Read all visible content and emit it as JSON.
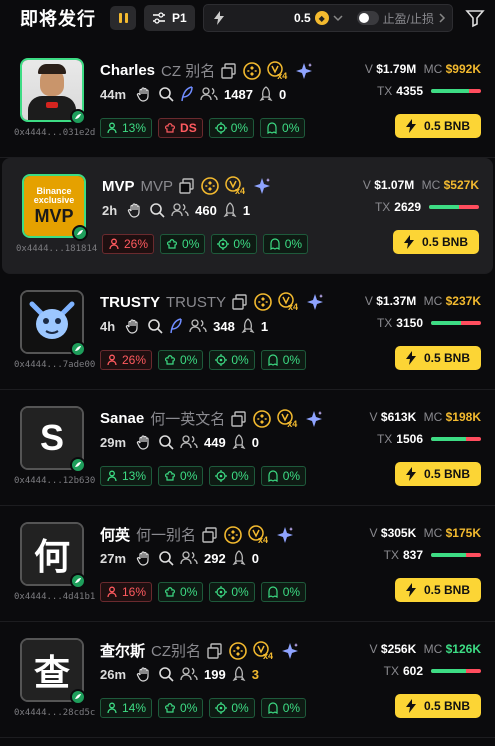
{
  "header": {
    "title": "即将发行",
    "preset_label": "P1",
    "quick_amount": "0.5",
    "tpsl_label": "止盈/止损"
  },
  "cards": [
    {
      "name": "Charles",
      "alias": "CZ 别名",
      "age": "44m",
      "holders": "1487",
      "snipers": "0",
      "address": "0x4444...031e2d",
      "volume": "$1.79M",
      "mcap": "$992K",
      "tx": "4355",
      "buy_ratio": 0.75,
      "stats": [
        "13%",
        "DS",
        "0%",
        "0%"
      ],
      "stat_colors": [
        "green",
        "red",
        "green",
        "green"
      ],
      "avatar": "photo",
      "highlight": false,
      "mc_color": "#f3ba2f"
    },
    {
      "name": "MVP",
      "alias": "MVP",
      "age": "2h",
      "holders": "460",
      "snipers": "1",
      "address": "0x4444...181814",
      "volume": "$1.07M",
      "mcap": "$527K",
      "tx": "2629",
      "buy_ratio": 0.6,
      "stats": [
        "26%",
        "0%",
        "0%",
        "0%"
      ],
      "stat_colors": [
        "red",
        "green",
        "green",
        "green"
      ],
      "avatar": "mvp",
      "highlight": true,
      "mc_color": "#f3ba2f"
    },
    {
      "name": "TRUSTY",
      "alias": "TRUSTY",
      "age": "4h",
      "holders": "348",
      "snipers": "1",
      "address": "0x4444...7ade00",
      "volume": "$1.37M",
      "mcap": "$237K",
      "tx": "3150",
      "buy_ratio": 0.6,
      "stats": [
        "26%",
        "0%",
        "0%",
        "0%"
      ],
      "stat_colors": [
        "red",
        "green",
        "green",
        "green"
      ],
      "avatar": "trusty",
      "highlight": false,
      "mc_color": "#f3ba2f"
    },
    {
      "name": "Sanae",
      "alias": "何一英文名",
      "age": "29m",
      "holders": "449",
      "snipers": "0",
      "address": "0x4444...12b630",
      "volume": "$613K",
      "mcap": "$198K",
      "tx": "1506",
      "buy_ratio": 0.7,
      "stats": [
        "13%",
        "0%",
        "0%",
        "0%"
      ],
      "stat_colors": [
        "green",
        "green",
        "green",
        "green"
      ],
      "avatar": "S",
      "highlight": false,
      "mc_color": "#f3ba2f"
    },
    {
      "name": "何英",
      "alias": "何一别名",
      "age": "27m",
      "holders": "292",
      "snipers": "0",
      "address": "0x4444...4d41b1",
      "volume": "$305K",
      "mcap": "$175K",
      "tx": "837",
      "buy_ratio": 0.7,
      "stats": [
        "16%",
        "0%",
        "0%",
        "0%"
      ],
      "stat_colors": [
        "red",
        "green",
        "green",
        "green"
      ],
      "avatar": "何",
      "highlight": false,
      "mc_color": "#f3ba2f"
    },
    {
      "name": "查尔斯",
      "alias": "CZ别名",
      "age": "26m",
      "holders": "199",
      "snipers": "3",
      "address": "0x4444...28cd5c",
      "volume": "$256K",
      "mcap": "$126K",
      "tx": "602",
      "buy_ratio": 0.7,
      "stats": [
        "14%",
        "0%",
        "0%",
        "0%"
      ],
      "stat_colors": [
        "green",
        "green",
        "green",
        "green"
      ],
      "avatar": "查",
      "highlight": false,
      "mc_color": "#3ddc84"
    }
  ],
  "labels": {
    "v": "V",
    "mc": "MC",
    "tx": "TX",
    "buy_amount": "0.5 BNB",
    "x4": "x4"
  },
  "icons": [
    "pause-icon",
    "sliders-icon",
    "bolt-icon",
    "bnb-coin-icon",
    "chevron-down-icon",
    "filter-icon",
    "copy-icon",
    "bnb-icon",
    "x4-badge-icon",
    "sparkle-icon",
    "hand-icon",
    "search-icon",
    "feather-icon",
    "users-icon",
    "rocket-icon",
    "chef-icon",
    "target-icon",
    "ghost-icon"
  ]
}
